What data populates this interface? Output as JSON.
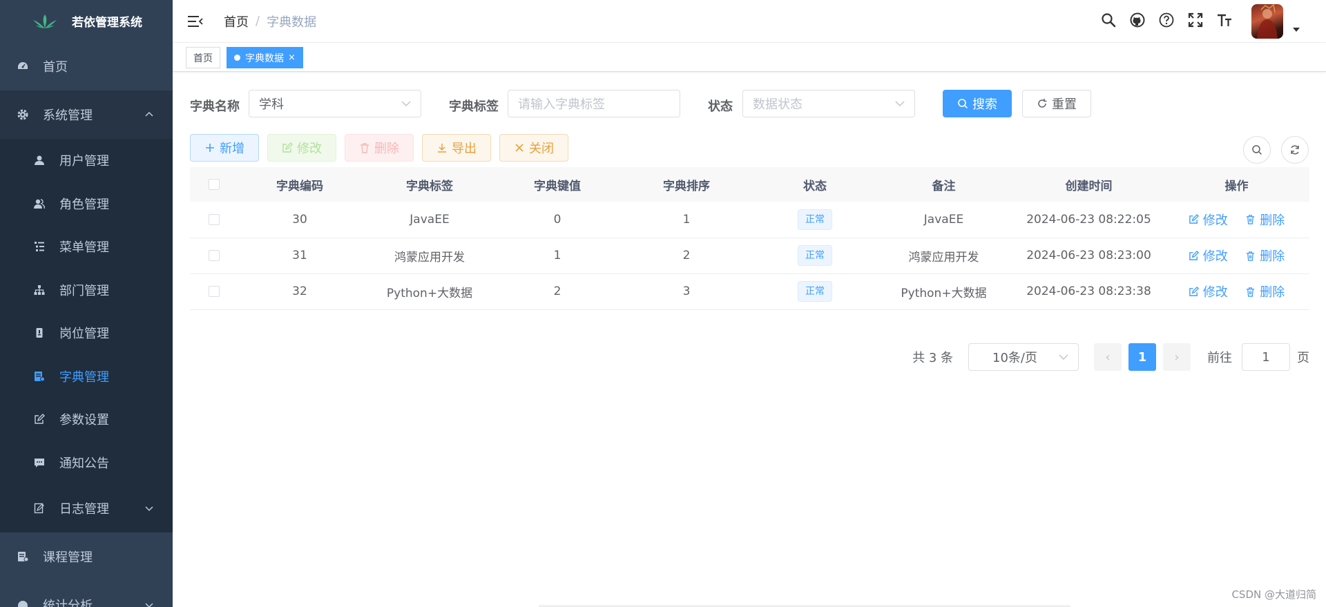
{
  "app": {
    "title": "若依管理系统"
  },
  "sidebar": {
    "items": [
      {
        "label": "首页"
      },
      {
        "label": "系统管理"
      },
      {
        "label": "课程管理"
      },
      {
        "label": "统计分析"
      }
    ],
    "system_sub": [
      {
        "label": "用户管理"
      },
      {
        "label": "角色管理"
      },
      {
        "label": "菜单管理"
      },
      {
        "label": "部门管理"
      },
      {
        "label": "岗位管理"
      },
      {
        "label": "字典管理"
      },
      {
        "label": "参数设置"
      },
      {
        "label": "通知公告"
      },
      {
        "label": "日志管理"
      }
    ]
  },
  "header": {
    "breadcrumb_home": "首页",
    "breadcrumb_sep": "/",
    "breadcrumb_current": "字典数据"
  },
  "tags": [
    {
      "label": "首页"
    },
    {
      "label": "字典数据",
      "close": "×"
    }
  ],
  "search": {
    "dict_name_label": "字典名称",
    "dict_name_value": "学科",
    "dict_label_label": "字典标签",
    "dict_label_placeholder": "请输入字典标签",
    "status_label": "状态",
    "status_placeholder": "数据状态",
    "search_btn": "搜索",
    "reset_btn": "重置"
  },
  "toolbar": {
    "add": "新增",
    "edit": "修改",
    "delete": "删除",
    "export": "导出",
    "close": "关闭"
  },
  "table": {
    "headers": [
      "字典编码",
      "字典标签",
      "字典键值",
      "字典排序",
      "状态",
      "备注",
      "创建时间",
      "操作"
    ],
    "rows": [
      {
        "code": "30",
        "label": "JavaEE",
        "value": "0",
        "sort": "1",
        "status": "正常",
        "remark": "JavaEE",
        "created": "2024-06-23 08:22:05"
      },
      {
        "code": "31",
        "label": "鸿蒙应用开发",
        "value": "1",
        "sort": "2",
        "status": "正常",
        "remark": "鸿蒙应用开发",
        "created": "2024-06-23 08:23:00"
      },
      {
        "code": "32",
        "label": "Python+大数据",
        "value": "2",
        "sort": "3",
        "status": "正常",
        "remark": "Python+大数据",
        "created": "2024-06-23 08:23:38"
      }
    ],
    "op_edit": "修改",
    "op_delete": "删除"
  },
  "pagination": {
    "total": "共 3 条",
    "page_size": "10条/页",
    "prev": "‹",
    "current": "1",
    "next": "›",
    "goto_label": "前往",
    "goto_value": "1",
    "page_suffix": "页"
  },
  "watermark": "CSDN @大道归简",
  "colors": {
    "primary": "#409eff",
    "sidebar_bg": "#304156",
    "sidebar_sub_bg": "#1f2d3d"
  }
}
